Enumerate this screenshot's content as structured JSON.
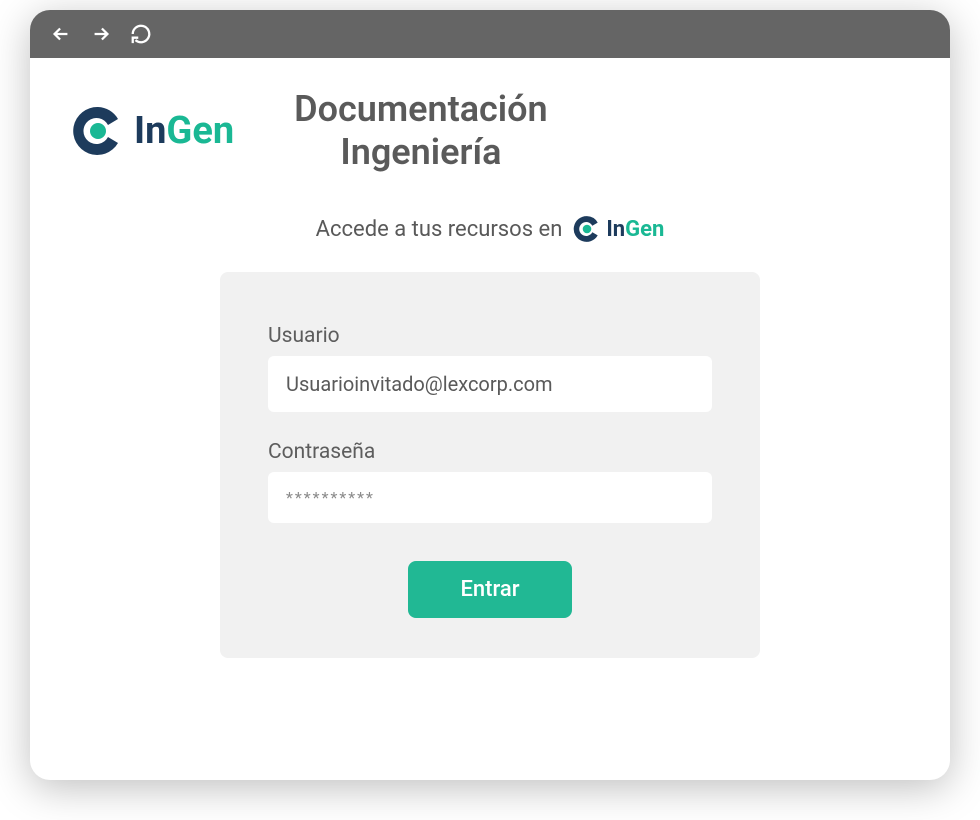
{
  "brand": {
    "name_part1": "In",
    "name_part2": "Gen"
  },
  "header": {
    "title_line1": "Documentación",
    "title_line2": "Ingeniería"
  },
  "subtitle": {
    "text": "Accede a tus recursos en"
  },
  "login": {
    "username_label": "Usuario",
    "username_value": "Usuarioinvitado@lexcorp.com",
    "password_label": "Contraseña",
    "password_value": "**********",
    "submit_label": "Entrar"
  },
  "colors": {
    "brand_dark": "#1d3b5c",
    "brand_teal": "#1ab894",
    "button": "#21b894"
  }
}
